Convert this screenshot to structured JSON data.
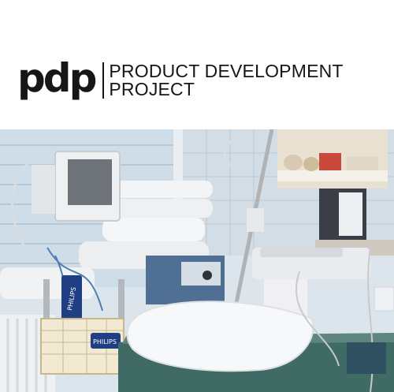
{
  "brand": {
    "mark": "pdp",
    "line1": "PRODUCT DEVELOPMENT",
    "line2": "PROJECT"
  },
  "photo": {
    "basket_label_1": "PHILIPS",
    "basket_label_2": "PHILIPS"
  },
  "colors": {
    "text": "#161616",
    "background": "#ffffff",
    "wall": "#dfe6ec",
    "tile": "#c7d4df",
    "mattress": "#3f6b64",
    "machine_blue": "#4f6f95"
  }
}
